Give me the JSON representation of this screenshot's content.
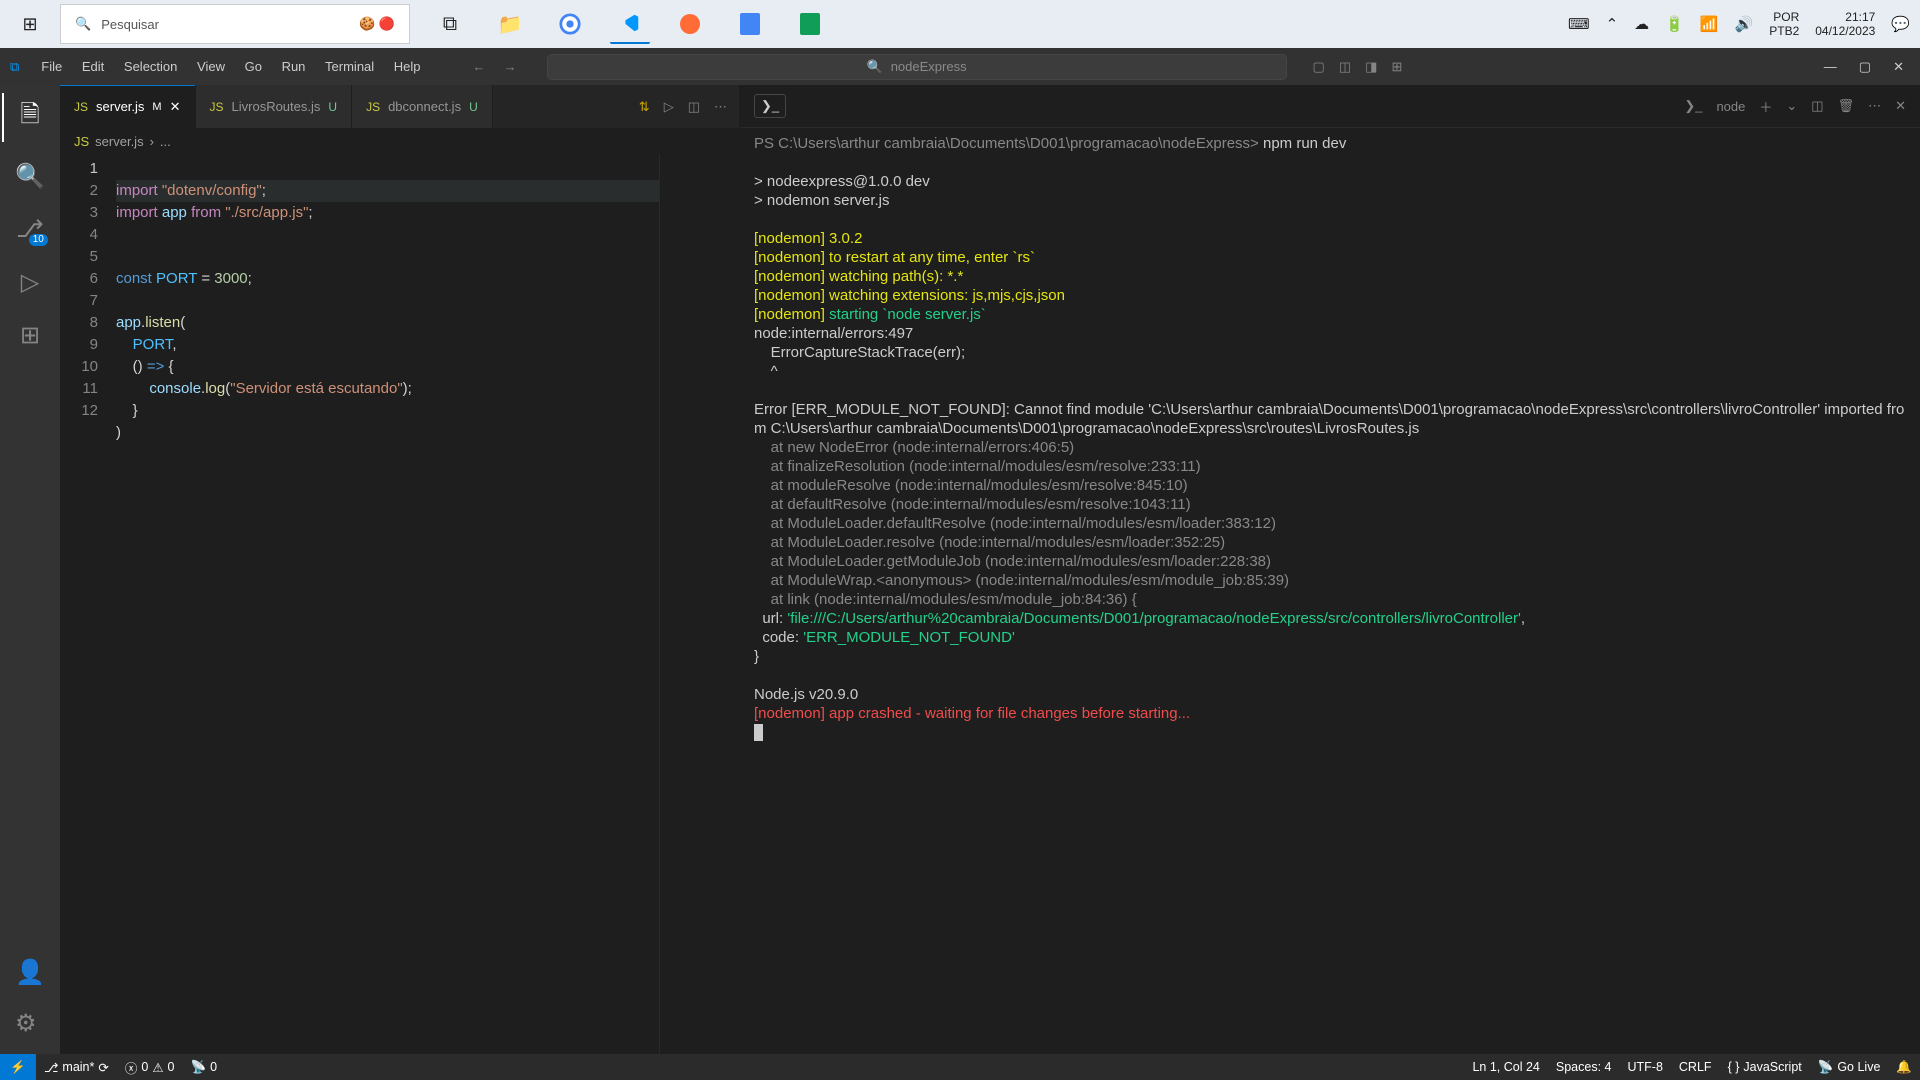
{
  "taskbar": {
    "search_placeholder": "Pesquisar",
    "lang": "POR",
    "kbd": "PTB2",
    "time": "21:17",
    "date": "04/12/2023"
  },
  "menu": {
    "file": "File",
    "edit": "Edit",
    "selection": "Selection",
    "view": "View",
    "go": "Go",
    "run": "Run",
    "terminal": "Terminal",
    "help": "Help"
  },
  "command_center": "nodeExpress",
  "scm_badge": "10",
  "tabs": {
    "t1_name": "server.js",
    "t1_mod": "M",
    "t2_name": "LivrosRoutes.js",
    "t2_mod": "U",
    "t3_name": "dbconnect.js",
    "t3_mod": "U"
  },
  "breadcrumb": {
    "file": "server.js",
    "sep": "›",
    "rest": "..."
  },
  "lines": [
    "1",
    "2",
    "3",
    "4",
    "5",
    "6",
    "7",
    "8",
    "9",
    "10",
    "11",
    "12"
  ],
  "code": {
    "l1a": "import",
    "l1b": " \"dotenv/config\"",
    "l1c": ";",
    "l2a": "import",
    "l2b": " app ",
    "l2c": "from",
    "l2d": " \"./src/app.js\"",
    "l2e": ";",
    "l5a": "const",
    "l5b": " PORT ",
    "l5c": "= ",
    "l5d": "3000",
    "l5e": ";",
    "l7a": "app",
    "l7b": ".",
    "l7c": "listen",
    "l7d": "(",
    "l8a": "    PORT",
    "l8b": ",",
    "l9a": "    () ",
    "l9b": "=>",
    "l9c": " {",
    "l10a": "        console",
    "l10b": ".",
    "l10c": "log",
    "l10d": "(",
    "l10e": "\"Servidor está escutando\"",
    "l10f": ");",
    "l11": "    }",
    "l12": ")"
  },
  "term": {
    "node_label": "node",
    "prompt": "PS C:\\Users\\arthur cambraia\\Documents\\D001\\programacao\\nodeExpress> ",
    "cmd": "npm run dev",
    "r1": "> nodeexpress@1.0.0 dev",
    "r2": "> nodemon server.js",
    "n1": "[nodemon] 3.0.2",
    "n2": "[nodemon] to restart at any time, enter `rs`",
    "n3": "[nodemon] watching path(s): *.*",
    "n4": "[nodemon] watching extensions: js,mjs,cjs,json",
    "n5a": "[nodemon] ",
    "n5b": "starting `node server.js`",
    "e1": "node:internal/errors:497",
    "e2": "    ErrorCaptureStackTrace(err);",
    "e3": "    ^",
    "err": "Error [ERR_MODULE_NOT_FOUND]: Cannot find module 'C:\\Users\\arthur cambraia\\Documents\\D001\\programacao\\nodeExpress\\src\\controllers\\livroController' imported from C:\\Users\\arthur cambraia\\Documents\\D001\\programacao\\nodeExpress\\src\\routes\\LivrosRoutes.js",
    "st1": "    at new NodeError (node:internal/errors:406:5)",
    "st2": "    at finalizeResolution (node:internal/modules/esm/resolve:233:11)",
    "st3": "    at moduleResolve (node:internal/modules/esm/resolve:845:10)",
    "st4": "    at defaultResolve (node:internal/modules/esm/resolve:1043:11)",
    "st5": "    at ModuleLoader.defaultResolve (node:internal/modules/esm/loader:383:12)",
    "st6": "    at ModuleLoader.resolve (node:internal/modules/esm/loader:352:25)",
    "st7": "    at ModuleLoader.getModuleJob (node:internal/modules/esm/loader:228:38)",
    "st8": "    at ModuleWrap.<anonymous> (node:internal/modules/esm/module_job:85:39)",
    "st9": "    at link (node:internal/modules/esm/module_job:84:36) {",
    "url1": "  url: ",
    "url2": "'file:///C:/Users/arthur%20cambraia/Documents/D001/programacao/nodeExpress/src/controllers/livroController'",
    "url3": ",",
    "code1": "  code: ",
    "code2": "'ERR_MODULE_NOT_FOUND'",
    "brace": "}",
    "ver": "Node.js v20.9.0",
    "crash": "[nodemon] app crashed - waiting for file changes before starting..."
  },
  "status": {
    "branch": "main*",
    "errors": "0",
    "warnings": "0",
    "port": "0",
    "ln": "Ln 1, Col 24",
    "spaces": "Spaces: 4",
    "enc": "UTF-8",
    "eol": "CRLF",
    "lang": "JavaScript",
    "golive": "Go Live"
  }
}
